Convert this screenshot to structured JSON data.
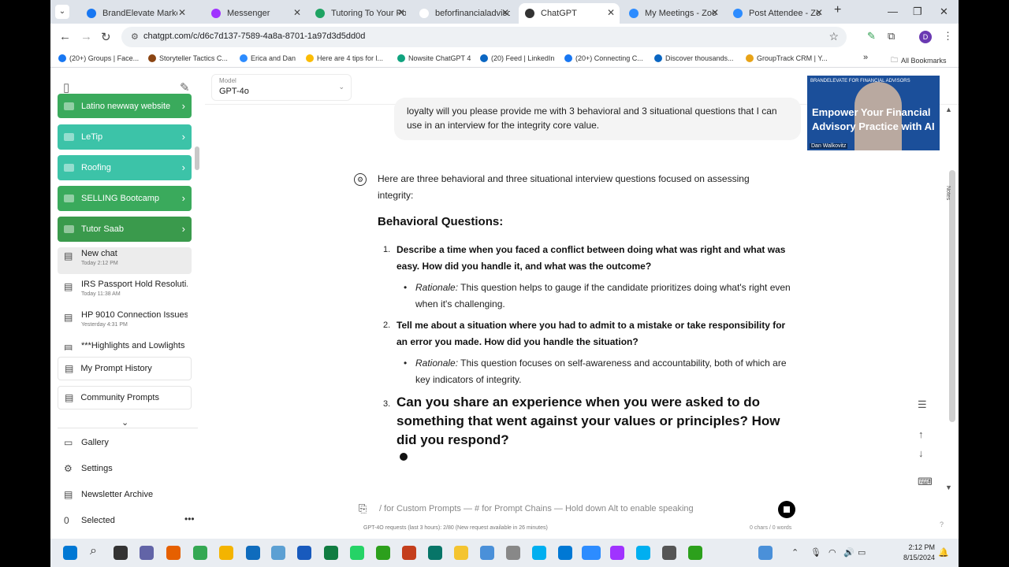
{
  "browser": {
    "tabs": [
      {
        "label": "BrandElevate Marke",
        "color": "#1877f2"
      },
      {
        "label": "Messenger",
        "color": "#a033ff"
      },
      {
        "label": "Tutoring To Your Po",
        "color": "#1ea362"
      },
      {
        "label": "beforfinancialadvisc",
        "color": "#aaaaaa"
      },
      {
        "label": "ChatGPT",
        "color": "#333333"
      },
      {
        "label": "My Meetings - Zoo",
        "color": "#2d8cff"
      },
      {
        "label": "Post Attendee - Zo",
        "color": "#2d8cff"
      }
    ],
    "url": "chatgpt.com/c/d6c7d137-7589-4a8a-8701-1a97d3d5dd0d",
    "profile_initial": "D",
    "bookmarks": [
      {
        "label": "(20+) Groups | Face...",
        "color": "#1877f2"
      },
      {
        "label": "Storyteller Tactics C...",
        "color": "#8b4513"
      },
      {
        "label": "Erica and Dan",
        "color": "#2d8cff"
      },
      {
        "label": "Here are 4 tips for l...",
        "color": "#fbbc04"
      },
      {
        "label": "Nowsite ChatGPT 4",
        "color": "#10a37f"
      },
      {
        "label": "(20) Feed | LinkedIn",
        "color": "#0a66c2"
      },
      {
        "label": "(20+) Connecting C...",
        "color": "#1877f2"
      },
      {
        "label": "Discover thousands...",
        "color": "#0a66c2"
      },
      {
        "label": "GroupTrack CRM | Y...",
        "color": "#e8a317"
      }
    ],
    "all_bookmarks": "All Bookmarks"
  },
  "sidebar": {
    "folders": [
      {
        "label": "Latino newway website",
        "color": "#3aaa5c"
      },
      {
        "label": "LeTip",
        "color": "#3cc3a8"
      },
      {
        "label": "Roofing",
        "color": "#3cc3a8"
      },
      {
        "label": "SELLING Bootcamp",
        "color": "#3aaa5c"
      },
      {
        "label": "Tutor Saab",
        "color": "#3a9a4c"
      }
    ],
    "chats": [
      {
        "title": "New chat",
        "date": "Today 2:12 PM"
      },
      {
        "title": "IRS Passport Hold Resoluti...",
        "date": "Today 11:38 AM"
      },
      {
        "title": "HP 9010 Connection Issues",
        "date": "Yesterday 4:31 PM"
      },
      {
        "title": "***Highlights and Lowlights",
        "date": ""
      }
    ],
    "my_prompt_history": "My Prompt History",
    "community_prompts": "Community Prompts",
    "gallery": "Gallery",
    "settings": "Settings",
    "newsletter_archive": "Newsletter Archive",
    "selected_count": "0",
    "selected_label": "Selected"
  },
  "main": {
    "model_label": "Model",
    "model_value": "GPT-4o",
    "user_message": "loyalty will you please provide me with 3 behavioral and 3 situational questions that I can use in an interview for the integrity core value.",
    "intro": "Here are three behavioral and three situational interview questions focused on assessing integrity:",
    "behavioral_heading": "Behavioral Questions:",
    "questions": [
      {
        "num": "1.",
        "text": "Describe a time when you faced a conflict between doing what was right and what was easy. How did you handle it, and what was the outcome?",
        "rationale_label": "Rationale:",
        "rationale": " This question helps to gauge if the candidate prioritizes doing what's right even when it's challenging."
      },
      {
        "num": "2.",
        "text": "Tell me about a situation where you had to admit to a mistake or take responsibility for an error you made. How did you handle the situation?",
        "rationale_label": "Rationale:",
        "rationale": " This question focuses on self-awareness and accountability, both of which are key indicators of integrity."
      },
      {
        "num": "3.",
        "text": "Can you share an experience when you were asked to do something that went against your values or principles? How did you respond?"
      }
    ],
    "prompt_placeholder": "/ for Custom Prompts — # for Prompt Chains — Hold down Alt to enable speaking",
    "request_info": "GPT-4O requests (last 3 hours): 2/80 (New request available in 26 minutes)",
    "chars_info": "0 chars / 0 words"
  },
  "zoom": {
    "banner": "BRANDELEVATE FOR FINANCIAL ADVISORS",
    "headline": "Empower Your Financial Advisory Practice with AI",
    "participant": "Dan Walkovitz"
  },
  "taskbar": {
    "time": "2:12 PM",
    "date": "8/15/2024"
  }
}
